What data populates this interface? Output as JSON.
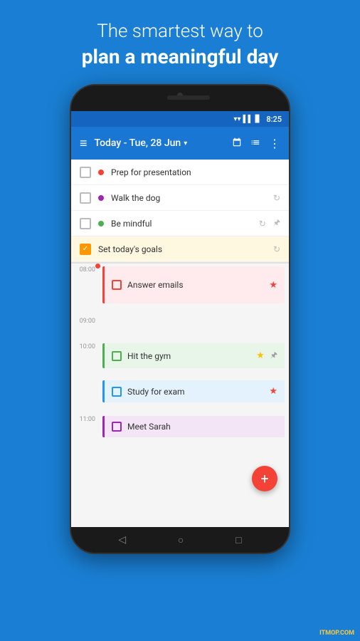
{
  "header": {
    "tagline_regular": "The smartest way to",
    "tagline_bold": "plan a meaningful day"
  },
  "status_bar": {
    "time": "8:25",
    "wifi": "▼",
    "signal": "▌▌",
    "battery": "▊"
  },
  "toolbar": {
    "menu_icon": "≡",
    "title": "Today - Tue, 28 Jun",
    "chevron": "▾",
    "calendar_icon": "📅",
    "list_icon": "📋",
    "more_icon": "⋮"
  },
  "tasks": [
    {
      "id": "prep",
      "text": "Prep for presentation",
      "dot_color": "#f44336",
      "checked": false,
      "repeat": false,
      "pin": false
    },
    {
      "id": "dog",
      "text": "Walk the dog",
      "dot_color": "#9c27b0",
      "checked": false,
      "repeat": true,
      "pin": false
    },
    {
      "id": "mindful",
      "text": "Be mindful",
      "dot_color": "#4caf50",
      "checked": false,
      "repeat": true,
      "pin": true
    }
  ],
  "goal_item": {
    "text": "Set today's goals",
    "checked": true,
    "repeat": true
  },
  "schedule": [
    {
      "time": "08:00",
      "tasks": [
        {
          "id": "emails",
          "text": "Answer emails",
          "color": "red",
          "star": true,
          "pin": false,
          "star_color": "red"
        }
      ]
    },
    {
      "time": "09:00",
      "tasks": []
    },
    {
      "time": "10:00",
      "tasks": [
        {
          "id": "gym",
          "text": "Hit the gym",
          "color": "green",
          "star": true,
          "pin": true,
          "star_color": "yellow"
        }
      ]
    },
    {
      "time": "",
      "tasks": [
        {
          "id": "study",
          "text": "Study for exam",
          "color": "blue",
          "star": true,
          "pin": false,
          "star_color": "red"
        }
      ]
    },
    {
      "time": "11:00",
      "tasks": [
        {
          "id": "sarah",
          "text": "Meet Sarah",
          "color": "purple",
          "star": false,
          "pin": false,
          "star_color": ""
        }
      ]
    }
  ],
  "fab": {
    "label": "+"
  },
  "nav": {
    "back": "◁",
    "home": "○",
    "recent": "□"
  },
  "watermark": "ITMOP.COM"
}
